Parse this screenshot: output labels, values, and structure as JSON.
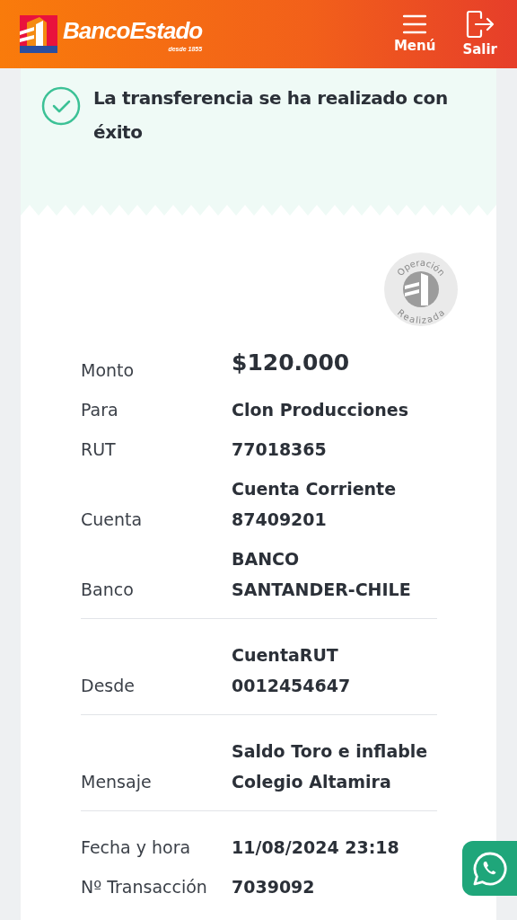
{
  "header": {
    "brand": "BancoEstado",
    "tagline": "desde 1855",
    "actions": [
      {
        "kind": "menu",
        "label": "Menú"
      },
      {
        "kind": "exit",
        "label": "Salir"
      }
    ]
  },
  "success": {
    "message": "La transferencia se ha realizado con éxito"
  },
  "stamp": {
    "top": "Operación",
    "bottom": "Realizada"
  },
  "sections": [
    {
      "rows": [
        {
          "kind": "amount",
          "label": "Monto",
          "value": [
            "$120.000"
          ]
        },
        {
          "kind": "text",
          "label": "Para",
          "value": [
            "Clon Producciones"
          ]
        },
        {
          "kind": "text",
          "label": "RUT",
          "value": [
            "77018365"
          ]
        },
        {
          "kind": "text",
          "label": "Cuenta",
          "value": [
            "Cuenta Corriente",
            "87409201"
          ]
        },
        {
          "kind": "text",
          "label": "Banco",
          "value": [
            "BANCO",
            "SANTANDER-CHILE"
          ]
        }
      ]
    },
    {
      "rows": [
        {
          "kind": "text",
          "label": "Desde",
          "value": [
            "CuentaRUT",
            "0012454647"
          ]
        }
      ]
    },
    {
      "rows": [
        {
          "kind": "text",
          "label": "Mensaje",
          "value": [
            "Saldo Toro e inflable",
            "Colegio Altamira"
          ]
        }
      ]
    },
    {
      "rows": [
        {
          "kind": "text",
          "label": "Fecha y hora",
          "value": [
            "11/08/2024 23:18"
          ]
        },
        {
          "kind": "text",
          "label": "Nº Transacción",
          "value": [
            "7039092"
          ]
        }
      ]
    }
  ]
}
